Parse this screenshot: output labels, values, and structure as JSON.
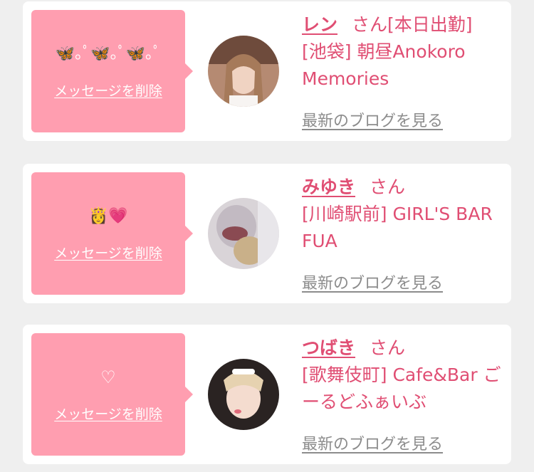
{
  "cards": [
    {
      "message": "🦋｡ﾟ🦋｡ﾟ🦋｡ﾟ",
      "delete_label": "メッセージを削除",
      "name": "レン",
      "honorific": "さん",
      "status": "[本日出勤]",
      "shop": "[池袋] 朝昼Anokoro Memories",
      "blog_link": "最新のブログを見る"
    },
    {
      "message": "👸💗",
      "delete_label": "メッセージを削除",
      "name": "みゆき",
      "honorific": "さん",
      "status": "",
      "shop": "[川崎駅前] GIRL'S BAR FUA",
      "blog_link": "最新のブログを見る"
    },
    {
      "message": "♡",
      "delete_label": "メッセージを削除",
      "name": "つばき",
      "honorific": "さん",
      "status": "",
      "shop": "[歌舞伎町] Cafe&Bar ごーるどふぁいぶ",
      "blog_link": "最新のブログを見る"
    }
  ],
  "colors": {
    "bubble": "#ff9eb0",
    "name": "#e04e73",
    "link_gray": "#8c8c8c"
  }
}
